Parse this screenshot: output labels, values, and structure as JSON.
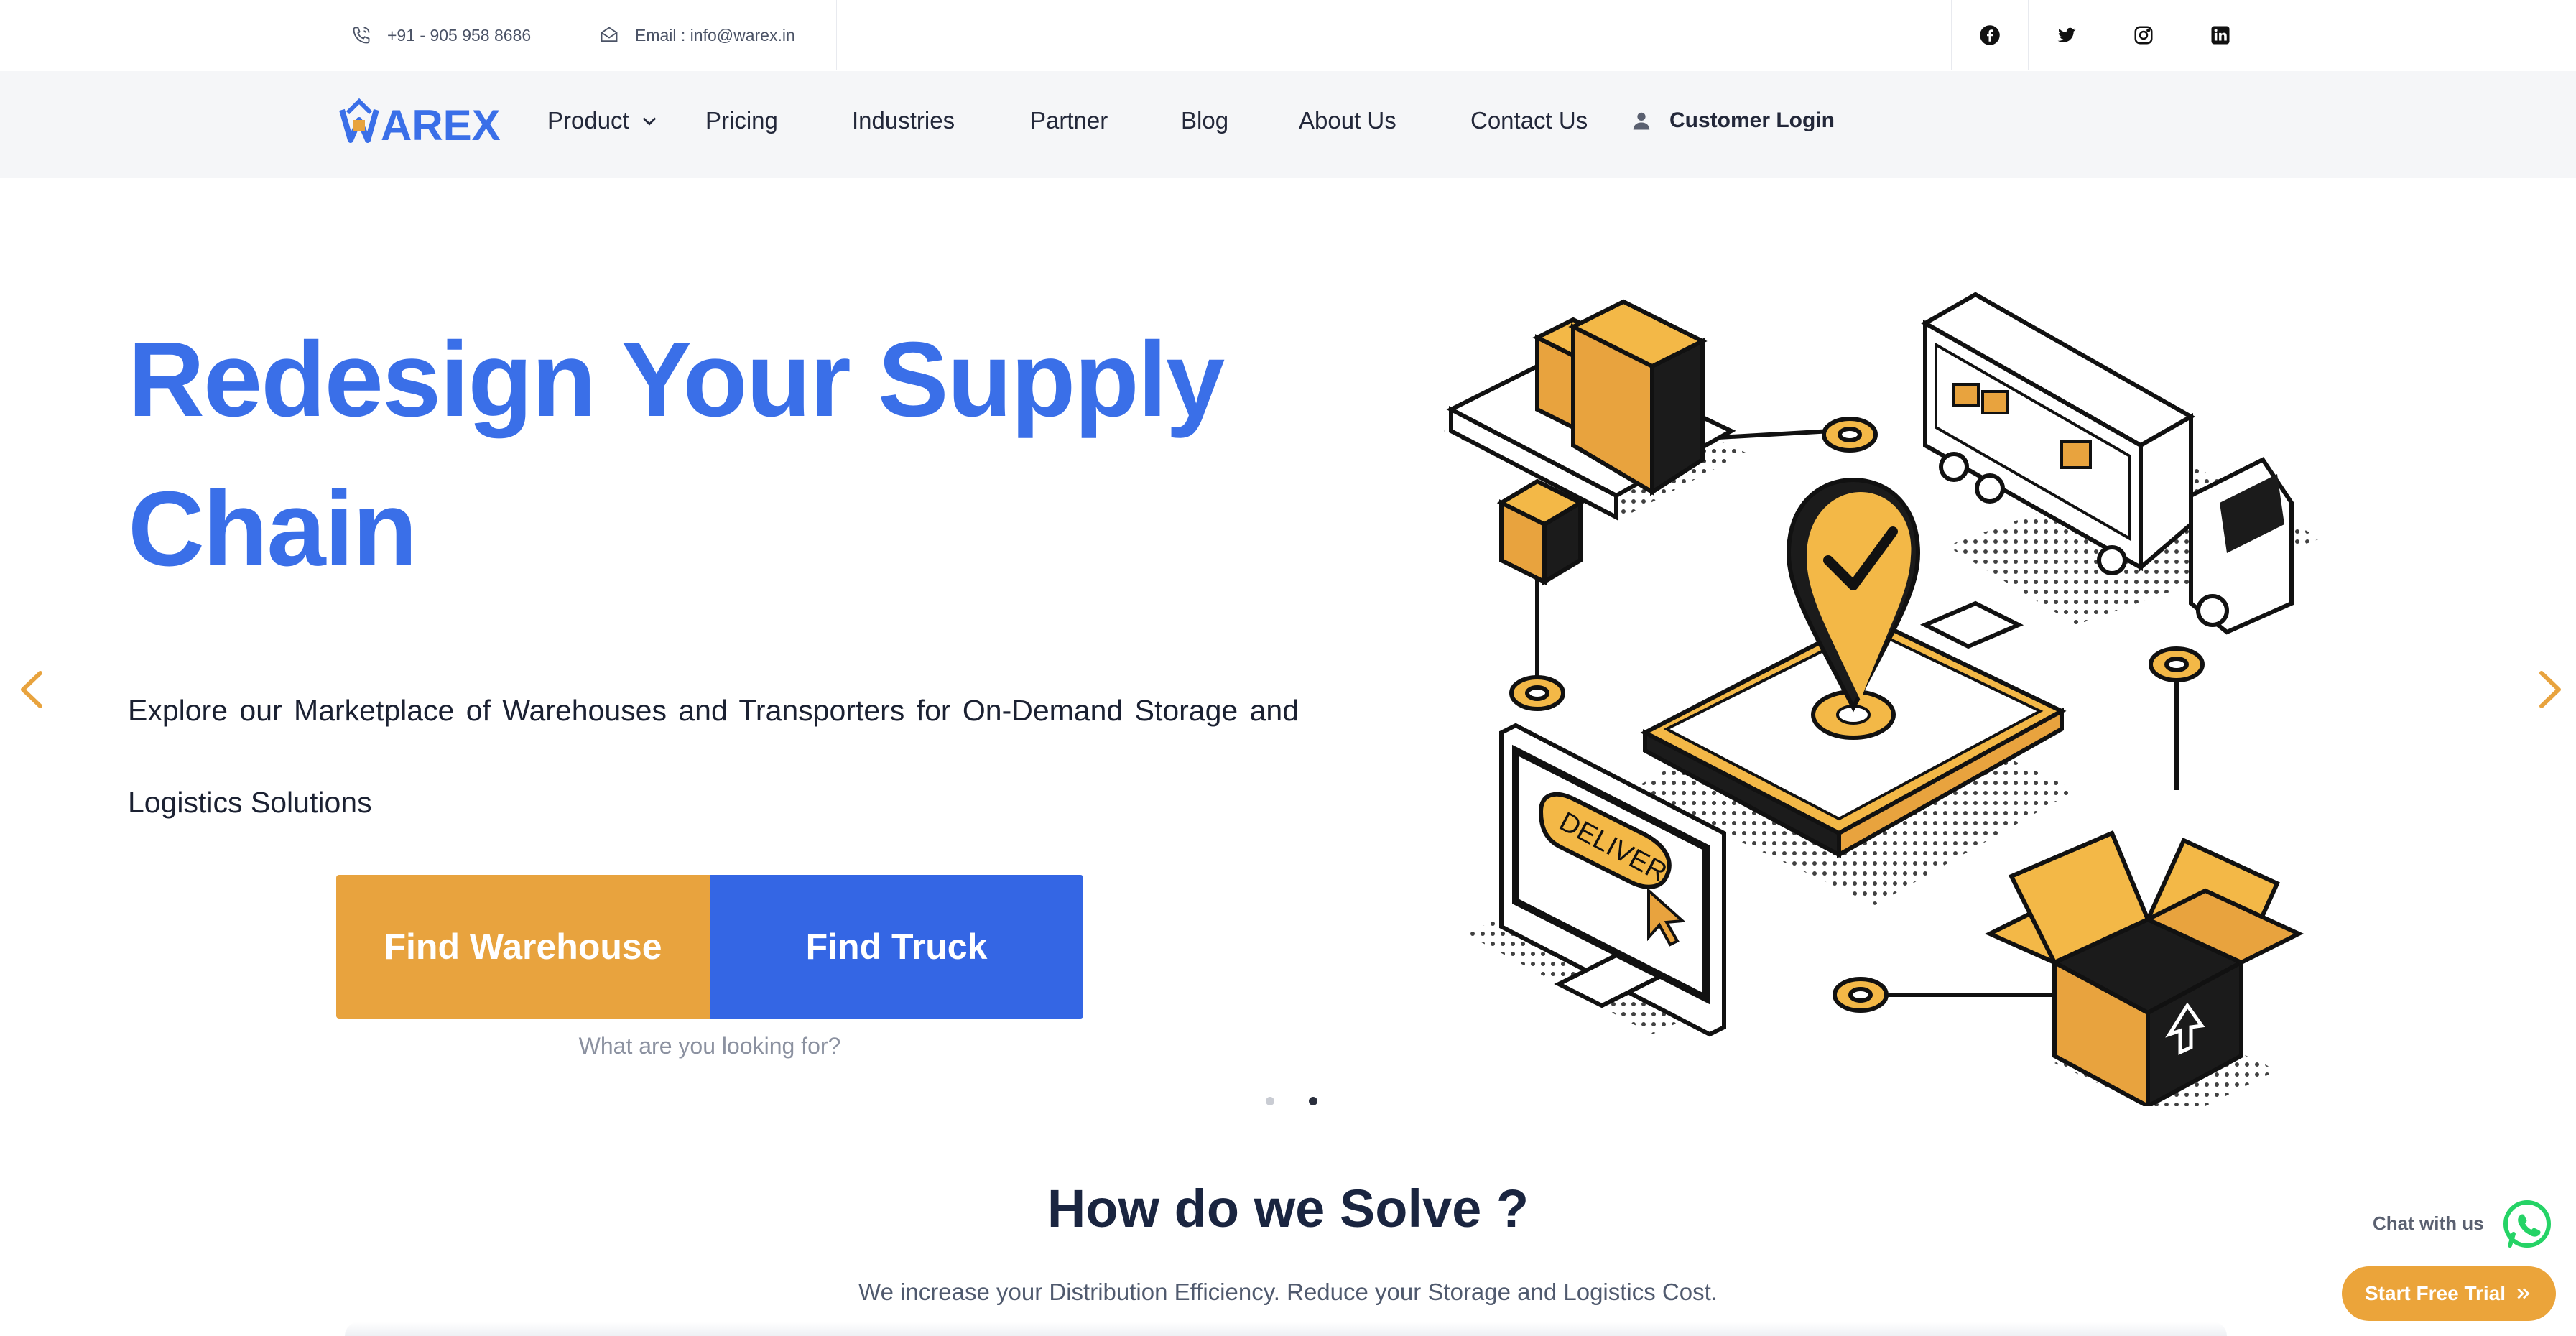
{
  "topbar": {
    "phone": "+91 - 905 958 8686",
    "email": "Email : info@warex.in",
    "social": [
      "facebook-icon",
      "twitter-icon",
      "instagram-icon",
      "linkedin-icon"
    ]
  },
  "nav": {
    "logo_text": "WAREX",
    "items": [
      "Product",
      "Pricing",
      "Industries",
      "Partner",
      "Blog",
      "About Us",
      "Contact Us"
    ],
    "login": "Customer Login"
  },
  "hero": {
    "title_line1": "Redesign Your Supply",
    "title_line2": "Chain",
    "subtitle": "Explore our Marketplace of Warehouses and Transporters for On-Demand Storage and Logistics Solutions",
    "btn_warehouse": "Find Warehouse",
    "btn_truck": "Find Truck",
    "hint": "What are you looking for?",
    "illustration_label": "DELIVER",
    "slides_total": 2,
    "active_slide": 2
  },
  "solve": {
    "title": "How do we Solve ?",
    "subtitle": "We increase your Distribution Efficiency. Reduce your Storage and Logistics Cost."
  },
  "widgets": {
    "chat": "Chat with us",
    "trial": "Start Free Trial"
  },
  "colors": {
    "brand_blue": "#3a6fe8",
    "button_blue": "#3466e4",
    "accent_orange": "#e8a33e",
    "whatsapp_green": "#25d366"
  }
}
